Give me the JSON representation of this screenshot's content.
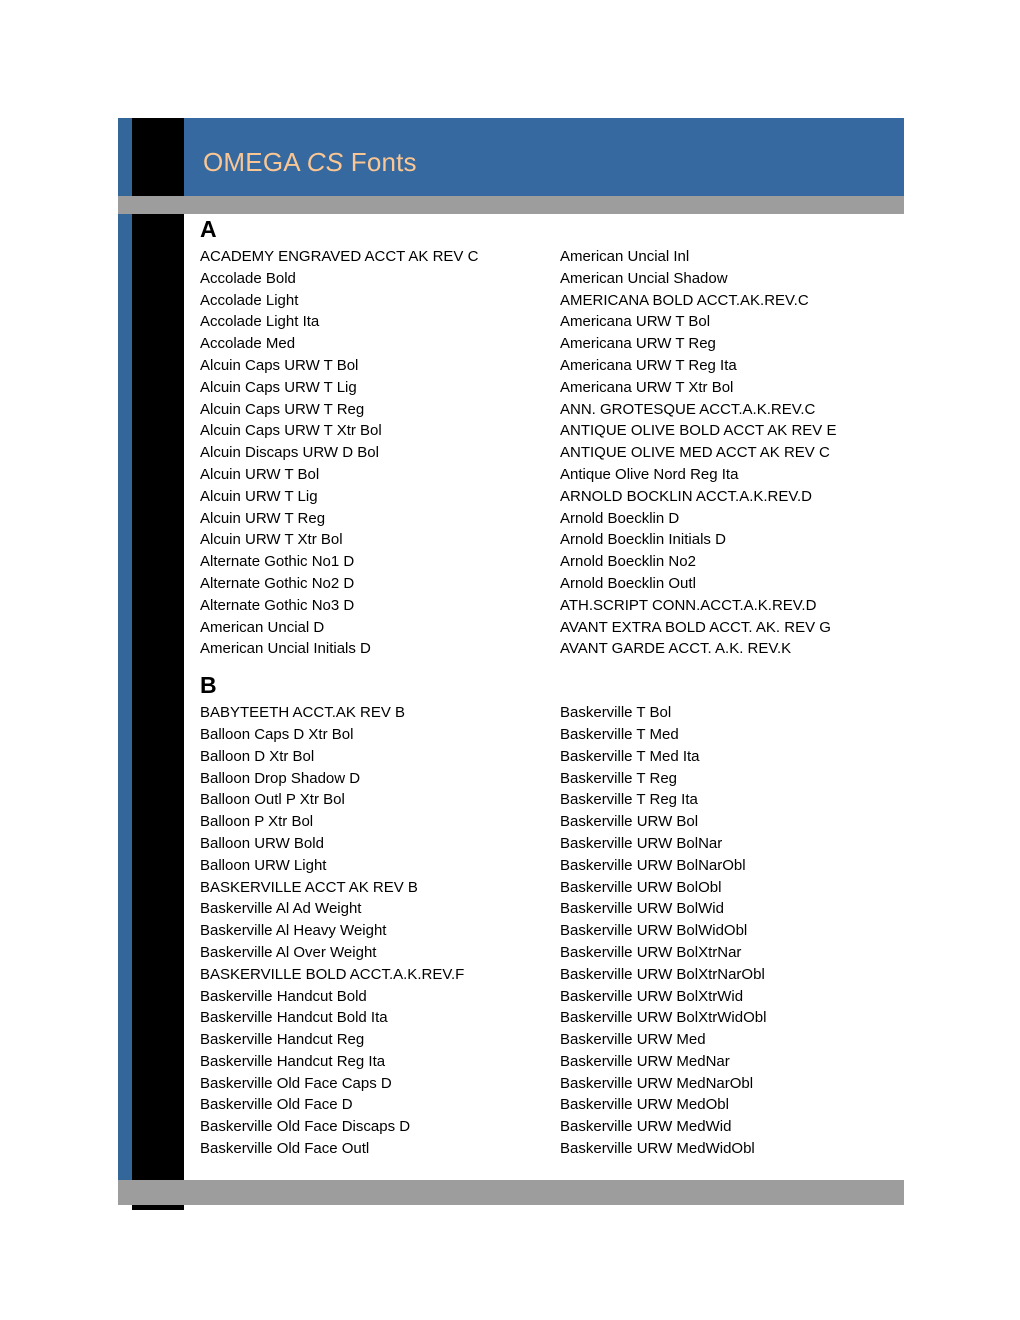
{
  "document": {
    "header": {
      "title_prefix": "OMEGA ",
      "title_italic": "CS",
      "title_suffix": " Fonts"
    },
    "colors": {
      "header_band": "#35699f",
      "header_title_text": "#fac794",
      "accent_blue_strip": "#336699",
      "grey_rule": "#9d9d9d",
      "black_bar": "#000000",
      "body_text": "#000000",
      "page_background": "#ffffff"
    }
  },
  "sections": [
    {
      "heading": "A",
      "left_column": [
        "ACADEMY ENGRAVED ACCT AK REV C",
        "Accolade Bold",
        "Accolade Light",
        "Accolade Light Ita",
        "Accolade Med",
        "Alcuin Caps URW T Bol",
        "Alcuin Caps URW T Lig",
        "Alcuin Caps URW T Reg",
        "Alcuin Caps URW T Xtr Bol",
        "Alcuin Discaps URW D Bol",
        "Alcuin URW T Bol",
        "Alcuin URW T Lig",
        "Alcuin URW T Reg",
        "Alcuin URW T Xtr Bol",
        "Alternate Gothic No1 D",
        "Alternate Gothic No2 D",
        "Alternate Gothic No3 D",
        "American Uncial D",
        "American Uncial Initials D"
      ],
      "right_column": [
        "American Uncial Inl",
        "American Uncial Shadow",
        "AMERICANA BOLD ACCT.AK.REV.C",
        "Americana URW T Bol",
        "Americana URW T Reg",
        "Americana URW T Reg Ita",
        "Americana URW T Xtr Bol",
        "ANN. GROTESQUE ACCT.A.K.REV.C",
        "ANTIQUE OLIVE BOLD ACCT AK REV E",
        "ANTIQUE OLIVE MED ACCT AK REV C",
        "Antique Olive Nord Reg Ita",
        "ARNOLD BOCKLIN ACCT.A.K.REV.D",
        "Arnold Boecklin D",
        "Arnold Boecklin Initials D",
        "Arnold Boecklin No2",
        "Arnold Boecklin Outl",
        "ATH.SCRIPT CONN.ACCT.A.K.REV.D",
        "AVANT EXTRA BOLD ACCT. AK. REV G",
        "AVANT GARDE ACCT. A.K. REV.K"
      ]
    },
    {
      "heading": "B",
      "left_column": [
        "BABYTEETH ACCT.AK REV B",
        "Balloon Caps D Xtr Bol",
        "Balloon D Xtr Bol",
        "Balloon Drop Shadow D",
        "Balloon Outl P Xtr Bol",
        "Balloon P Xtr Bol",
        "Balloon URW Bold",
        "Balloon URW Light",
        "BASKERVILLE ACCT AK REV B",
        "Baskerville Al Ad Weight",
        "Baskerville Al Heavy Weight",
        "Baskerville Al Over Weight",
        "BASKERVILLE BOLD ACCT.A.K.REV.F",
        "Baskerville Handcut Bold",
        "Baskerville Handcut Bold Ita",
        "Baskerville Handcut Reg",
        "Baskerville Handcut Reg Ita",
        "Baskerville Old Face Caps D",
        "Baskerville Old Face D",
        "Baskerville Old Face Discaps D",
        "Baskerville Old Face Outl"
      ],
      "right_column": [
        "Baskerville T Bol",
        "Baskerville T Med",
        "Baskerville T Med Ita",
        "Baskerville T Reg",
        "Baskerville T Reg Ita",
        "Baskerville URW Bol",
        "Baskerville URW BolNar",
        "Baskerville URW BolNarObl",
        "Baskerville URW BolObl",
        "Baskerville URW BolWid",
        "Baskerville URW BolWidObl",
        "Baskerville URW BolXtrNar",
        "Baskerville URW BolXtrNarObl",
        "Baskerville URW BolXtrWid",
        "Baskerville URW BolXtrWidObl",
        "Baskerville URW Med",
        "Baskerville URW MedNar",
        "Baskerville URW MedNarObl",
        "Baskerville URW MedObl",
        "Baskerville URW MedWid",
        "Baskerville URW MedWidObl"
      ]
    }
  ]
}
